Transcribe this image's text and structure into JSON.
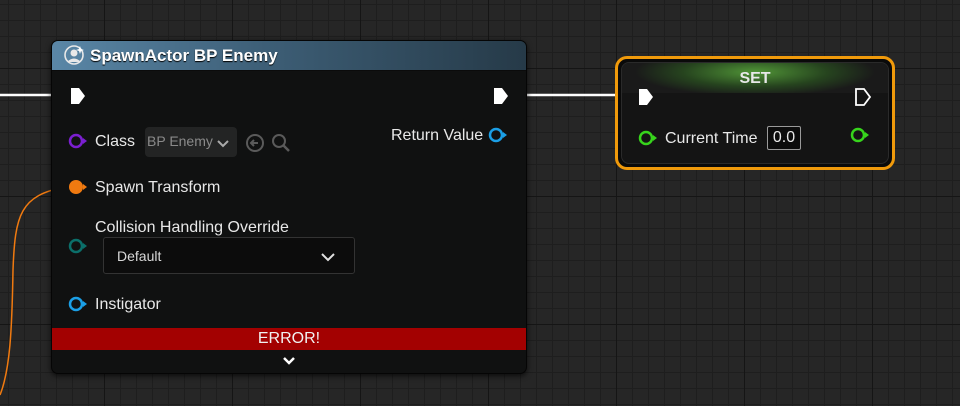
{
  "spawn_node": {
    "title": "SpawnActor BP Enemy",
    "class_label": "Class",
    "class_value": "BP Enemy",
    "return_value_label": "Return Value",
    "spawn_transform_label": "Spawn Transform",
    "collision_label": "Collision Handling Override",
    "collision_value": "Default",
    "instigator_label": "Instigator",
    "error_text": "ERROR!"
  },
  "set_node": {
    "title": "SET",
    "var_label": "Current Time",
    "var_value": "0.0"
  },
  "colors": {
    "exec": "#ffffff",
    "class_pin": "#7b1fd1",
    "transform_pin": "#f07a10",
    "enum_pin": "#0b6f6a",
    "object_pin": "#1b9fe6",
    "float_pin": "#37d41c",
    "error": "#a30101",
    "selection": "#f09a0b"
  },
  "icons": [
    "spawn-actor-icon",
    "class-dropdown-chevron-icon",
    "use-selected-icon",
    "browse-search-icon",
    "collision-dropdown-chevron-icon",
    "expand-chevron-icon"
  ]
}
